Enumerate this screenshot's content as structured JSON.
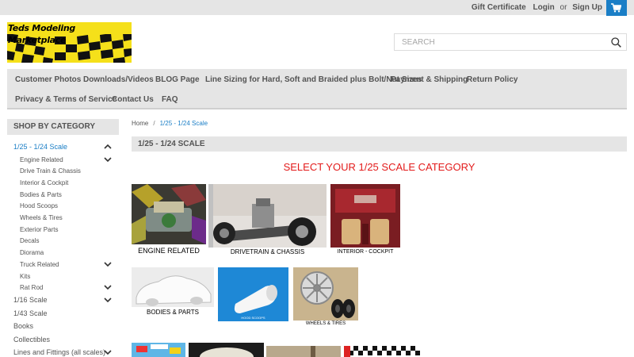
{
  "topbar": {
    "gift_certificate": "Gift Certificate",
    "login": "Login",
    "or": "or",
    "sign_up": "Sign Up",
    "cart_icon": "cart-icon",
    "accent_color": "#1a7ec6"
  },
  "header": {
    "logo_text": "Teds Modeling Marketplace",
    "search_placeholder": "SEARCH"
  },
  "nav": {
    "items": [
      "Customer Photos",
      "Downloads/Videos",
      "BLOG Page",
      "Line Sizing for Hard, Soft and Braided plus Bolt/Nut Sizes",
      "Payment & Shipping",
      "Return Policy",
      "Privacy & Terms of Service",
      "Contact Us",
      "FAQ"
    ]
  },
  "sidebar": {
    "heading": "SHOP BY CATEGORY",
    "items": [
      "1/25 - 1/24 Scale",
      "Engine Related",
      "Drive Train & Chassis",
      "Interior & Cockpit",
      "Bodies & Parts",
      "Hood Scoops",
      "Wheels & Tires",
      "Exterior Parts",
      "Decals",
      "Diorama",
      "Truck Related",
      "Kits",
      "Rat Rod",
      "1/16 Scale",
      "1/43 Scale",
      "Books",
      "Collectibles",
      "Lines and Fittings (all scales)"
    ]
  },
  "breadcrumb": {
    "home": "Home",
    "separator": "/",
    "current": "1/25 - 1/24 Scale"
  },
  "main": {
    "page_heading": "1/25 - 1/24 SCALE",
    "select_title": "SELECT YOUR 1/25 SCALE CATEGORY",
    "title_color": "#e31b1b",
    "tiles": [
      "ENGINE RELATED",
      "DRIVETRAIN & CHASSIS",
      "INTERIOR - COCKPIT",
      "BODIES & PARTS",
      "HOOD SCOOPS",
      "WHEELS & TIRES"
    ]
  }
}
